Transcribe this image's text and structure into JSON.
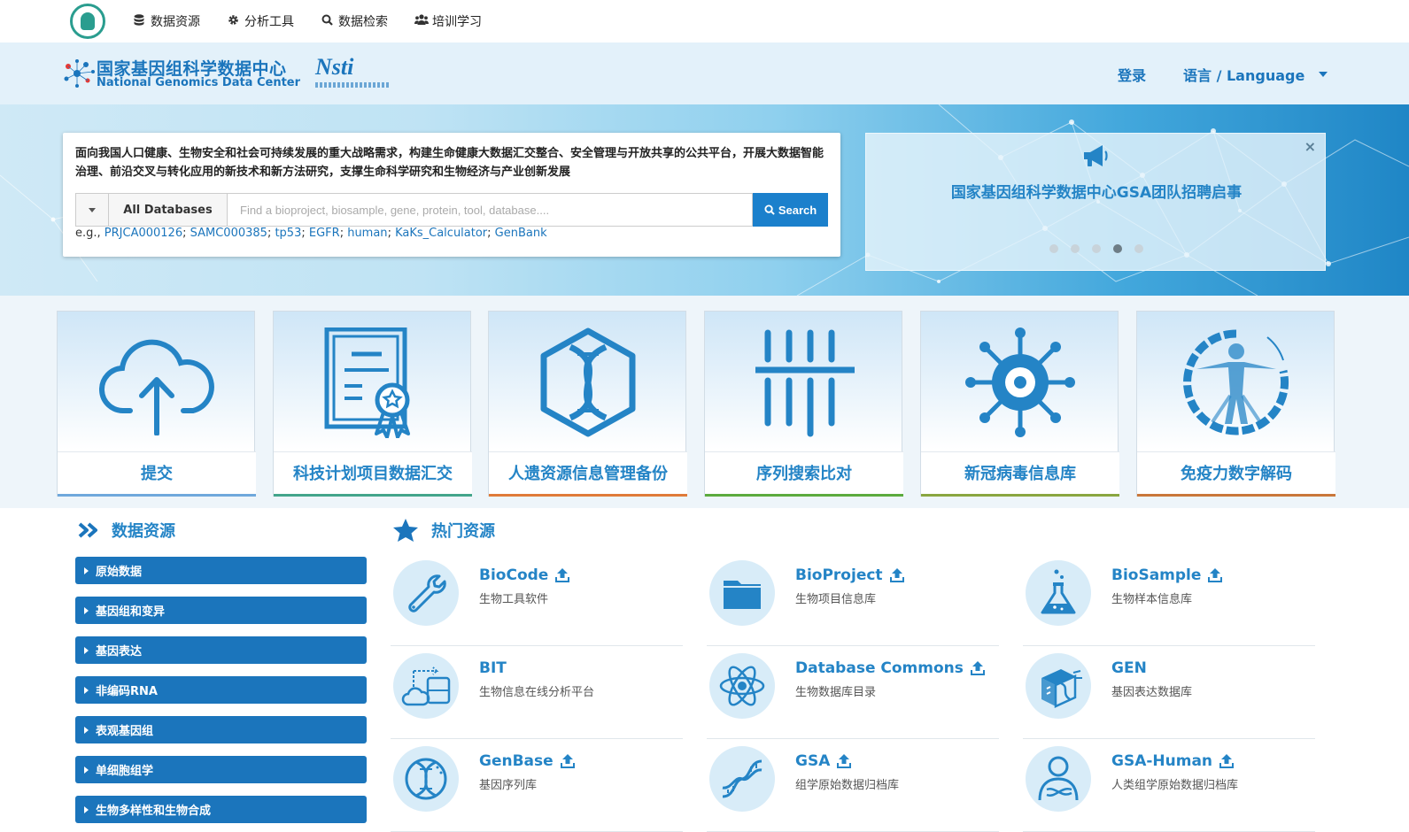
{
  "topnav": {
    "items": [
      {
        "label": "数据资源",
        "icon": "database-icon"
      },
      {
        "label": "分析工具",
        "icon": "gear-icon"
      },
      {
        "label": "数据检索",
        "icon": "search-icon"
      },
      {
        "label": "培训学习",
        "icon": "users-icon"
      }
    ]
  },
  "header": {
    "brand_cn": "国家基因组科学数据中心",
    "brand_en": "National Genomics Data Center",
    "partner_logo": "Nsti",
    "login": "登录",
    "language": "语言 / Language"
  },
  "hero": {
    "description": "面向我国人口健康、生物安全和社会可持续发展的重大战略需求，构建生命健康大数据汇交整合、安全管理与开放共享的公共平台，开展大数据智能治理、前沿交叉与转化应用的新技术和新方法研究，支撑生命科学研究和生物经济与产业创新发展",
    "select_label": "All Databases",
    "search_placeholder": "Find a bioproject, biosample, gene, protein, tool, database....",
    "search_button": "Search",
    "eg_prefix": "e.g.,",
    "examples": [
      "PRJCA000126",
      "SAMC000385",
      "tp53",
      "EGFR",
      "human",
      "KaKs_Calculator",
      "GenBank"
    ],
    "notice_title": "国家基因组科学数据中心GSA团队招聘启事",
    "notice_close": "×",
    "carousel_active": 4
  },
  "cards": [
    {
      "label": "提交",
      "icon": "cloud-upload-icon",
      "accent": "#6fa8dc"
    },
    {
      "label": "科技计划项目数据汇交",
      "icon": "certificate-icon",
      "accent": "#43a58b"
    },
    {
      "label": "人遗资源信息管理备份",
      "icon": "dna-hexagon-icon",
      "accent": "#e07b39"
    },
    {
      "label": "序列搜索比对",
      "icon": "sequence-bars-icon",
      "accent": "#5cab3e"
    },
    {
      "label": "新冠病毒信息库",
      "icon": "virus-icon",
      "accent": "#8aa640"
    },
    {
      "label": "免疫力数字解码",
      "icon": "vitruvian-icon",
      "accent": "#c9773a"
    }
  ],
  "data_resources": {
    "title": "数据资源",
    "items": [
      "原始数据",
      "基因组和变异",
      "基因表达",
      "非编码RNA",
      "表观基因组",
      "单细胞组学",
      "生物多样性和生物合成"
    ]
  },
  "hot_resources": {
    "title": "热门资源",
    "items": [
      {
        "name": "BioCode",
        "desc": "生物工具软件",
        "icon": "wrench-icon",
        "upload": true
      },
      {
        "name": "BioProject",
        "desc": "生物项目信息库",
        "icon": "folder-icon",
        "upload": true
      },
      {
        "name": "BioSample",
        "desc": "生物样本信息库",
        "icon": "flask-icon",
        "upload": true
      },
      {
        "name": "BIT",
        "desc": "生物信息在线分析平台",
        "icon": "cloud-transfer-icon",
        "upload": false
      },
      {
        "name": "Database Commons",
        "desc": "生物数据库目录",
        "icon": "atom-icon",
        "upload": true
      },
      {
        "name": "GEN",
        "desc": "基因表达数据库",
        "icon": "gene-cube-icon",
        "upload": false
      },
      {
        "name": "GenBase",
        "desc": "基因序列库",
        "icon": "dna-circle-icon",
        "upload": true
      },
      {
        "name": "GSA",
        "desc": "组学原始数据归档库",
        "icon": "dna-helix-icon",
        "upload": true
      },
      {
        "name": "GSA-Human",
        "desc": "人类组学原始数据归档库",
        "icon": "person-dna-icon",
        "upload": true
      }
    ]
  },
  "colors": {
    "primary": "#1b75bc",
    "accent": "#2484c6",
    "header_bg": "#e3f1fa"
  }
}
